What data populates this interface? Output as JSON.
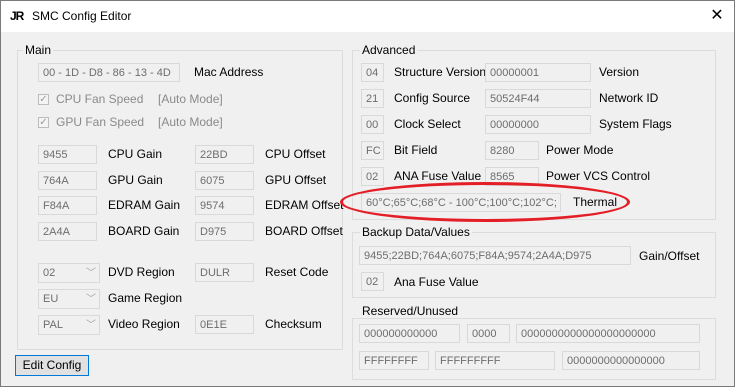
{
  "window": {
    "title": "SMC Config Editor",
    "icon_text": "JR",
    "close_glyph": "✕"
  },
  "main": {
    "legend": "Main",
    "mac": {
      "value": "00 - 1D - D8 - 86 - 13 - 4D",
      "label": "Mac Address"
    },
    "cpu_fan": {
      "label": "CPU Fan Speed",
      "mode": "[Auto Mode]"
    },
    "gpu_fan": {
      "label": "GPU Fan Speed",
      "mode": "[Auto Mode]"
    },
    "gains": [
      {
        "gain_value": "9455",
        "gain_label": "CPU Gain",
        "offset_value": "22BD",
        "offset_label": "CPU Offset"
      },
      {
        "gain_value": "764A",
        "gain_label": "GPU Gain",
        "offset_value": "6075",
        "offset_label": "GPU Offset"
      },
      {
        "gain_value": "F84A",
        "gain_label": "EDRAM Gain",
        "offset_value": "9574",
        "offset_label": "EDRAM Offset"
      },
      {
        "gain_value": "2A4A",
        "gain_label": "BOARD Gain",
        "offset_value": "D975",
        "offset_label": "BOARD Offset"
      }
    ],
    "dvd_region": {
      "value": "02",
      "label": "DVD Region"
    },
    "reset_code": {
      "value": "DULR",
      "label": "Reset Code"
    },
    "game_region": {
      "value": "EU",
      "label": "Game Region"
    },
    "video_region": {
      "value": "PAL",
      "label": "Video Region"
    },
    "checksum": {
      "value": "0E1E",
      "label": "Checksum"
    },
    "edit_button": "Edit Config"
  },
  "advanced": {
    "legend": "Advanced",
    "rows": [
      {
        "small": "04",
        "small_label": "Structure Version",
        "value": "00000001",
        "value_label": "Version"
      },
      {
        "small": "21",
        "small_label": "Config Source",
        "value": "50524F44",
        "value_label": "Network ID"
      },
      {
        "small": "00",
        "small_label": "Clock Select",
        "value": "00000000",
        "value_label": "System Flags"
      },
      {
        "small": "FC",
        "small_label": "Bit Field",
        "value": "8280",
        "value_label": "Power Mode"
      },
      {
        "small": "02",
        "small_label": "ANA Fuse Value",
        "value": "8565",
        "value_label": "Power VCS Control"
      }
    ],
    "thermal": {
      "value": "60°C;65°C;68°C - 100°C;100°C;102°C;",
      "label": "Thermal"
    }
  },
  "backup": {
    "legend": "Backup Data/Values",
    "gain_offset": {
      "value": "9455;22BD;764A;6075;F84A;9574;2A4A;D975",
      "label": "Gain/Offset"
    },
    "ana_fuse": {
      "value": "02",
      "label": "Ana Fuse Value"
    }
  },
  "reserved": {
    "legend": "Reserved/Unused",
    "row1": [
      "000000000000",
      "0000",
      "0000000000000000000000"
    ],
    "row2": [
      "FFFFFFFF",
      "FFFFFFFFF",
      "0000000000000000"
    ]
  },
  "colors": {
    "highlight": "#e41e26",
    "focus_border": "#0078d7"
  }
}
